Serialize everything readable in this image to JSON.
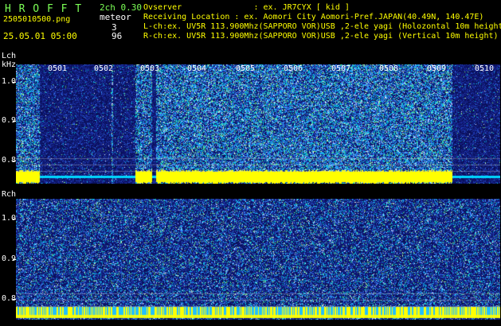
{
  "header": {
    "app_title": "H R O F F T",
    "channels": "2ch 0.30",
    "mode_label": "meteor",
    "filename": "2505010500.png",
    "count_l": "3",
    "count_r": "96",
    "timestamp": "25.05.01 05:00",
    "observer_line": "Ovserver               : ex. JR7CYX [ kid ]",
    "location_line": "Receiving Location : ex. Aomori City Aomori-Pref.JAPAN(40.49N, 140.47E)",
    "lch_line": "L-ch:ex. UV5R 113.900Mhz(SAPPORO VOR)USB ,2-ele yagi (Holozontal 10m height)",
    "rch_line": "R-ch:ex. UV5R 113.900Mhz(SAPPORO VOR)USB ,2-ele yagi (Vertical 10m height)"
  },
  "lch_panel": {
    "channel_label": "Lch",
    "unit_label": "kHz",
    "y_labels": [
      "1.0",
      "0.9",
      "0.8"
    ],
    "time_labels": [
      "0501",
      "0502",
      "0503",
      "0504",
      "0505",
      "0506",
      "0507",
      "0508",
      "0509",
      "0510"
    ]
  },
  "rch_panel": {
    "channel_label": "Rch",
    "y_labels": [
      "1.0",
      "0.9",
      "0.8"
    ]
  },
  "colors": {
    "header_green": "#7cff56",
    "header_white": "#ffffff",
    "header_yellow": "#ffff00",
    "background": "#000000",
    "spectrogram_noise_low": "#0b1060",
    "spectrogram_noise_high": "#3c9cff",
    "signal_band": "#ffff00",
    "cyan_band": "#00e0ff"
  }
}
